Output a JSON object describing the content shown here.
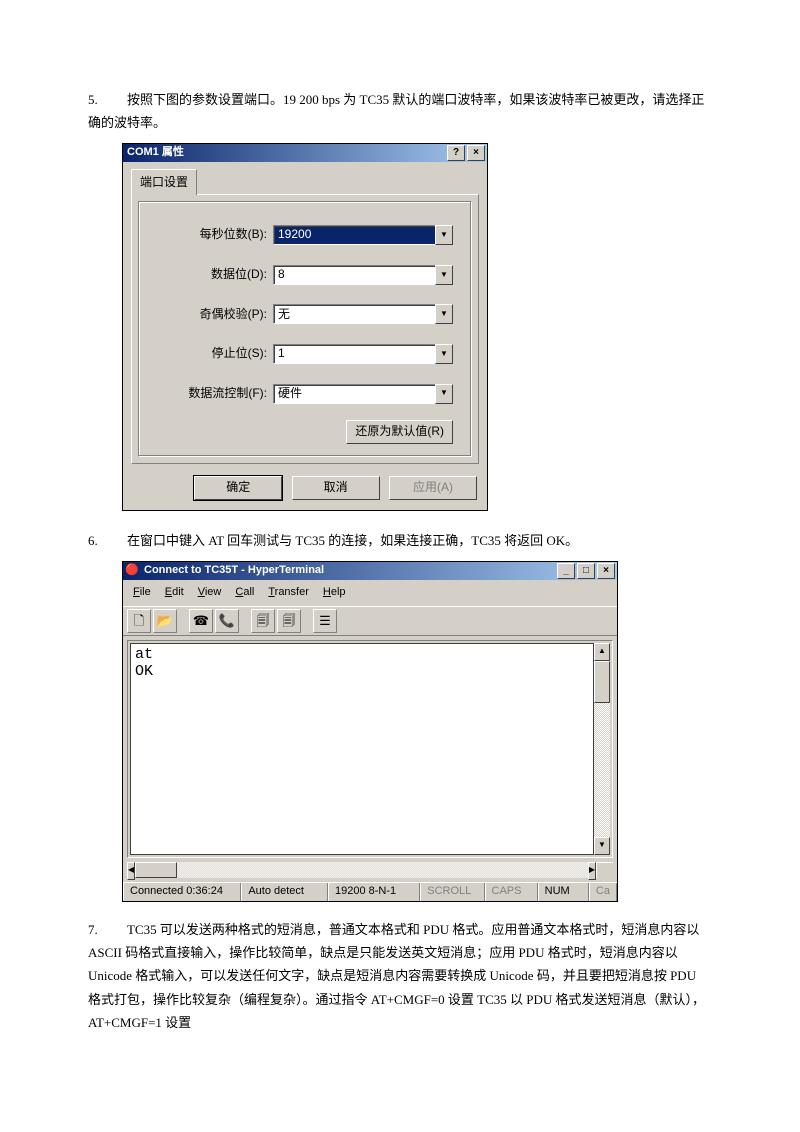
{
  "para5": "按照下图的参数设置端口。19 200 bps 为 TC35 默认的端口波特率，如果该波特率已被更改，请选择正确的波特率。",
  "para6": "在窗口中键入 AT 回车测试与 TC35 的连接，如果连接正确，TC35 将返回 OK。",
  "para7": "TC35 可以发送两种格式的短消息，普通文本格式和 PDU 格式。应用普通文本格式时，短消息内容以 ASCII 码格式直接输入，操作比较简单，缺点是只能发送英文短消息；应用 PDU 格式时，短消息内容以 Unicode 格式输入，可以发送任何文字，缺点是短消息内容需要转换成 Unicode 码，并且要把短消息按 PDU 格式打包，操作比较复杂（编程复杂）。通过指令 AT+CMGF=0 设置 TC35 以 PDU 格式发送短消息（默认），AT+CMGF=1 设置",
  "num5": "5.",
  "num6": "6.",
  "num7": "7.",
  "dialog": {
    "title": "COM1 属性",
    "help": "?",
    "close": "×",
    "tab": "端口设置",
    "labels": {
      "baud": "每秒位数(B):",
      "data": "数据位(D):",
      "parity": "奇偶校验(P):",
      "stop": "停止位(S):",
      "flow": "数据流控制(F):"
    },
    "values": {
      "baud": "19200",
      "data": "8",
      "parity": "无",
      "stop": "1",
      "flow": "硬件"
    },
    "restore": "还原为默认值(R)",
    "ok": "确定",
    "cancel": "取消",
    "apply": "应用(A)"
  },
  "win": {
    "title": "Connect to TC35T - HyperTerminal",
    "min": "_",
    "max": "□",
    "close": "×",
    "menu": {
      "file": "File",
      "edit": "Edit",
      "view": "View",
      "call": "Call",
      "transfer": "Transfer",
      "help": "Help"
    },
    "terminal": "at\nOK",
    "status": {
      "connected": "Connected 0:36:24",
      "auto": "Auto detect",
      "params": "19200 8-N-1",
      "scroll": "SCROLL",
      "caps": "CAPS",
      "num": "NUM",
      "cap": "Ca"
    }
  }
}
